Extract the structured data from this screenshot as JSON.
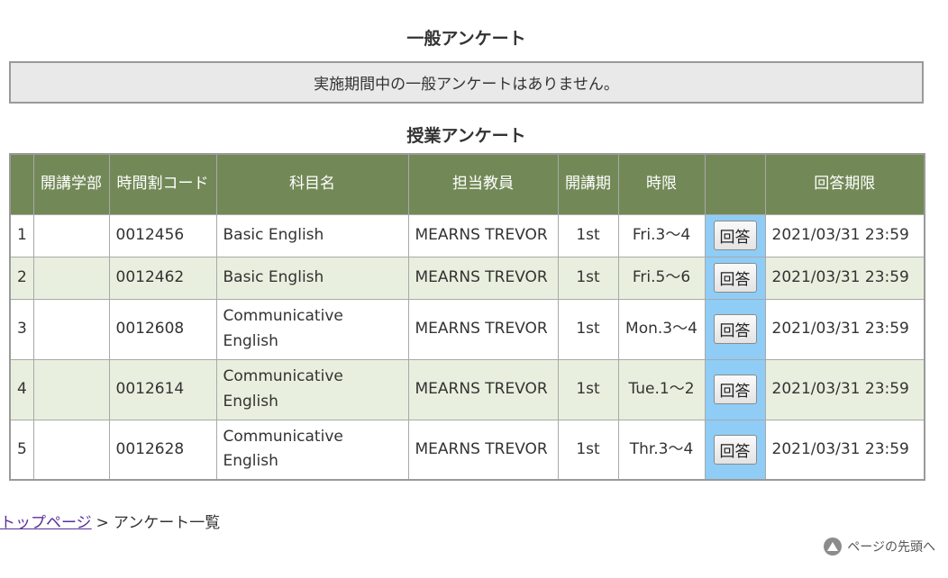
{
  "general_survey": {
    "title": "一般アンケート",
    "notice": "実施期間中の一般アンケートはありません。"
  },
  "class_survey": {
    "title": "授業アンケート",
    "headers": [
      "",
      "開講学部",
      "時間割コード",
      "科目名",
      "担当教員",
      "開講期",
      "時限",
      "",
      "回答期限"
    ],
    "button_label": "回答",
    "rows": [
      {
        "no": "1",
        "faculty": "",
        "code": "0012456",
        "subject": "Basic English",
        "teacher": "MEARNS TREVOR",
        "term": "1st",
        "period": "Fri.3～4",
        "deadline": "2021/03/31 23:59"
      },
      {
        "no": "2",
        "faculty": "",
        "code": "0012462",
        "subject": "Basic English",
        "teacher": "MEARNS TREVOR",
        "term": "1st",
        "period": "Fri.5～6",
        "deadline": "2021/03/31 23:59"
      },
      {
        "no": "3",
        "faculty": "",
        "code": "0012608",
        "subject": "Communicative English",
        "teacher": "MEARNS TREVOR",
        "term": "1st",
        "period": "Mon.3～4",
        "deadline": "2021/03/31 23:59"
      },
      {
        "no": "4",
        "faculty": "",
        "code": "0012614",
        "subject": "Communicative English",
        "teacher": "MEARNS TREVOR",
        "term": "1st",
        "period": "Tue.1～2",
        "deadline": "2021/03/31 23:59"
      },
      {
        "no": "5",
        "faculty": "",
        "code": "0012628",
        "subject": "Communicative English",
        "teacher": "MEARNS TREVOR",
        "term": "1st",
        "period": "Thr.3～4",
        "deadline": "2021/03/31 23:59"
      }
    ]
  },
  "breadcrumb": {
    "home_label": "トップページ",
    "separator": ">",
    "current_label": "アンケート一覧"
  },
  "page_top": {
    "label": "ページの先頭へ",
    "icon": "arrow-up-circle-icon"
  },
  "colors": {
    "header_bg": "#728957",
    "even_row_bg": "#e8efde",
    "button_cell_bg": "#8fcdf6",
    "notice_bg": "#e9e9e9"
  }
}
